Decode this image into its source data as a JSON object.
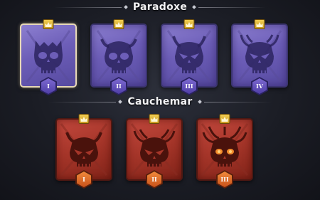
{
  "sections": {
    "paradoxe": {
      "title": "Paradoxe",
      "levels": [
        {
          "numeral": "I",
          "selected": true
        },
        {
          "numeral": "II",
          "selected": false
        },
        {
          "numeral": "III",
          "selected": false
        },
        {
          "numeral": "IV",
          "selected": false
        }
      ]
    },
    "cauchemar": {
      "title": "Cauchemar",
      "levels": [
        {
          "numeral": "I"
        },
        {
          "numeral": "II"
        },
        {
          "numeral": "III"
        }
      ]
    }
  },
  "icons": {
    "card_art": "skull-icon",
    "badge_top": "crown-icon",
    "badge_bottom": "level-hex-icon"
  },
  "colors": {
    "paradoxe_card": "#6d5eb8",
    "cauchemar_card": "#a53529",
    "selected_border": "#e8d9b6",
    "crown": "#e2b93b",
    "red_hex": "#e0702b"
  }
}
